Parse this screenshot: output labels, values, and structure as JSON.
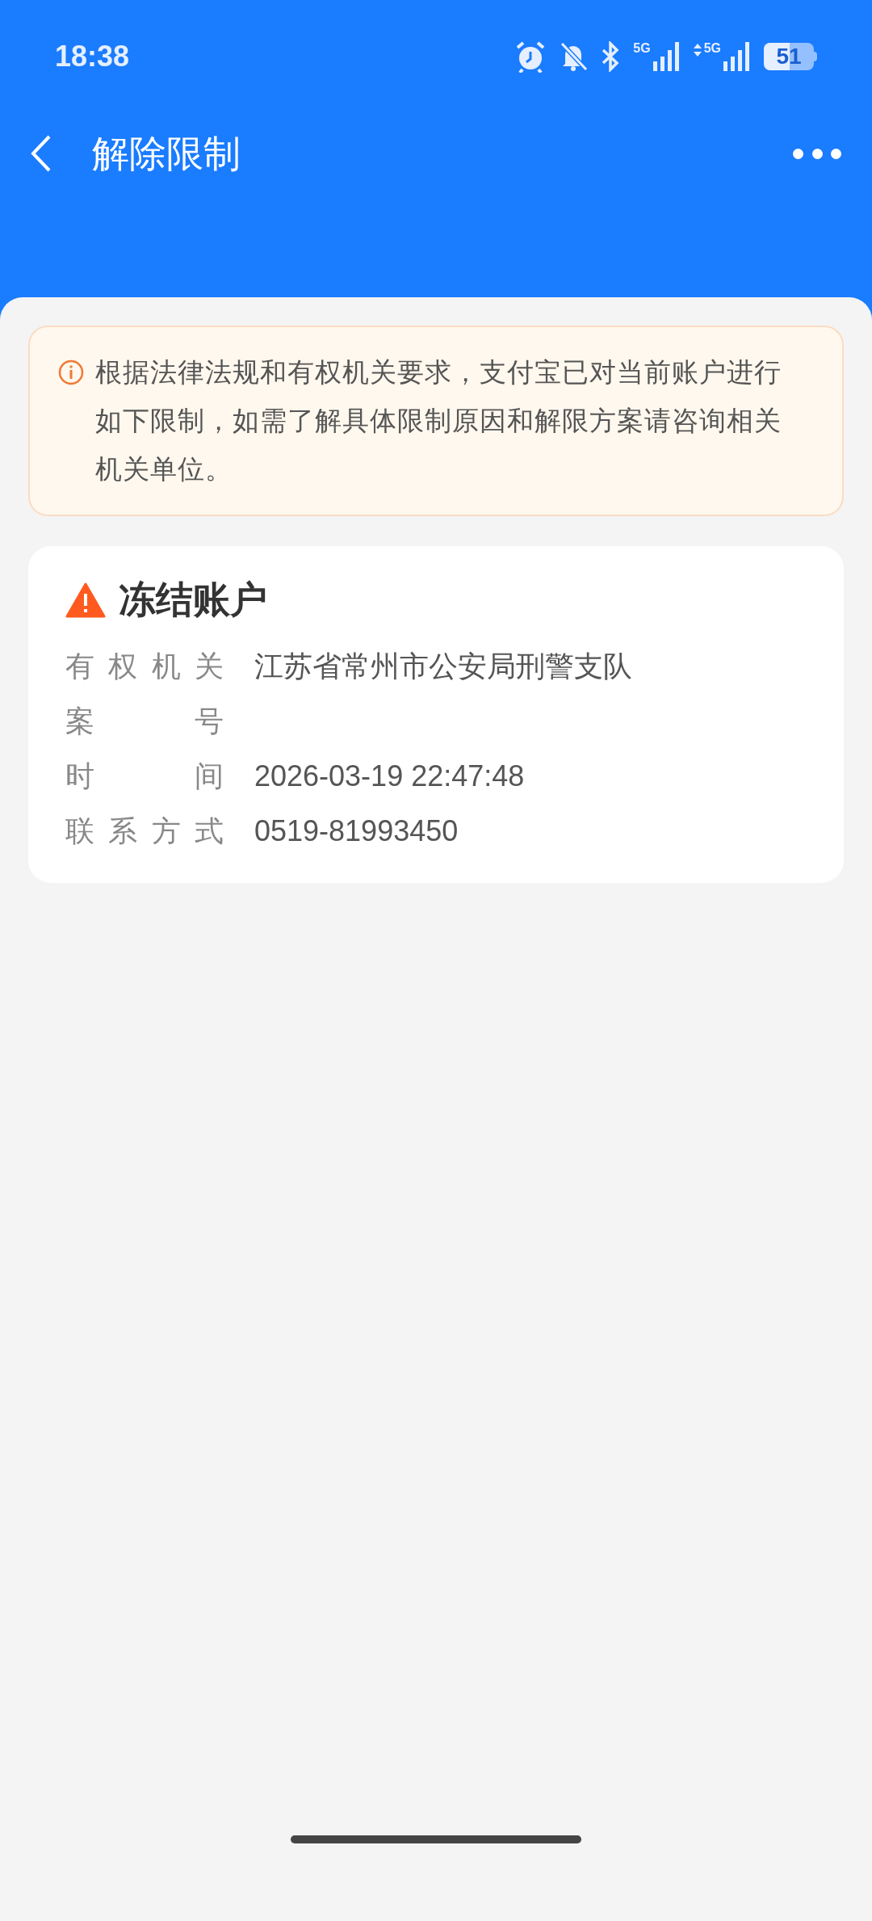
{
  "status_bar": {
    "time": "18:38",
    "network_1": "5G",
    "network_2": "5G",
    "battery": "51"
  },
  "header": {
    "title": "解除限制"
  },
  "notice": {
    "text": "根据法律法规和有权机关要求，支付宝已对当前账户进行如下限制，如需了解具体限制原因和解限方案请咨询相关机关单位。"
  },
  "restriction": {
    "title": "冻结账户",
    "fields": [
      {
        "label": "有权机关",
        "value": "江苏省常州市公安局刑警支队"
      },
      {
        "label": "案号"
      },
      {
        "label": "时间",
        "value": "2026-03-19 22:47:48"
      },
      {
        "label": "联系方式",
        "value": "0519-81993450"
      }
    ]
  }
}
